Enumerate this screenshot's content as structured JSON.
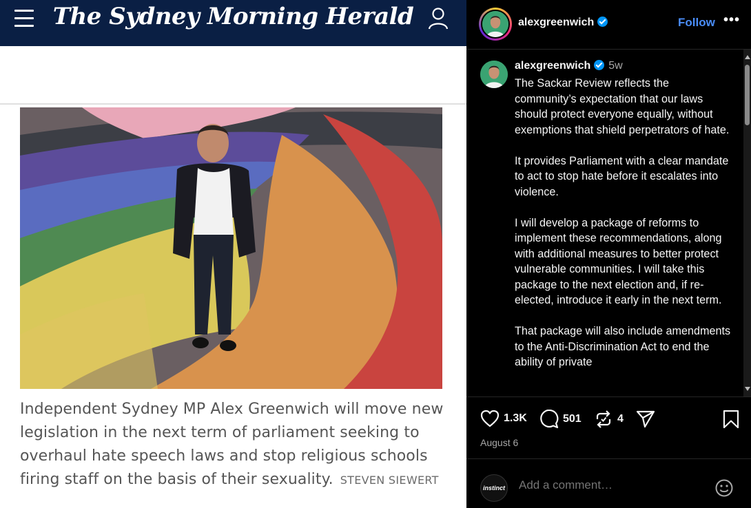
{
  "news": {
    "masthead": "The Sydney Morning Herald",
    "caption": "Independent Sydney MP Alex Greenwich will move new legislation in the next term of parliament seeking to overhaul hate speech laws and stop religious schools firing staff on the basis of their sexuality.",
    "credit": "STEVEN SIEWERT",
    "icons": [
      "menu-icon",
      "user-account-icon"
    ]
  },
  "instagram": {
    "header": {
      "username": "alexgreenwich",
      "verified": true,
      "follow_label": "Follow",
      "more_label": "•••"
    },
    "post": {
      "username": "alexgreenwich",
      "time": "5w",
      "body": "The Sackar Review reflects the community’s expectation that our laws should protect everyone equally, without exemptions that shield perpetrators of hate.\n\nIt provides Parliament with a clear mandate to act to stop hate before it escalates into violence.\n\nI will develop a package of reforms to implement these recommendations, along with additional measures to better protect vulnerable communities. I will take this package to the next election and, if re-elected, introduce it early in the next term.\n\nThat package will also include amendments to the Anti-Discrimination Act to end the ability of private"
    },
    "actions": {
      "likes": "1.3K",
      "comments": "501",
      "reposts": "4",
      "date": "August 6"
    },
    "comment": {
      "avatar_label": "instinct",
      "placeholder": "Add a comment…"
    },
    "colors": {
      "background": "#000000",
      "follow": "#4a8df8",
      "verified": "#0095f6"
    }
  }
}
